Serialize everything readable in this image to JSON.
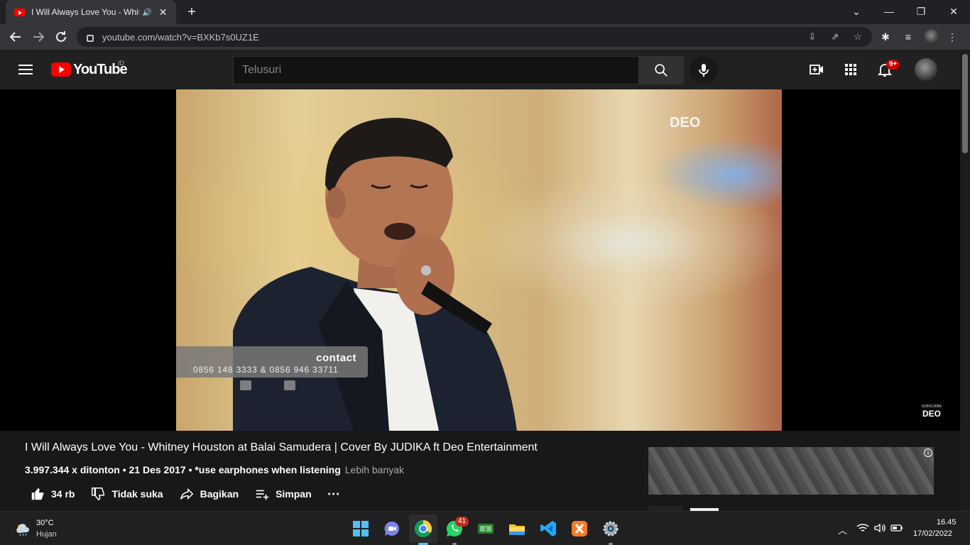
{
  "browser": {
    "tab_title": "I Will Always Love You - Whitney Houston at Balai Samudera",
    "url": "youtube.com/watch?v=BXKb7s0UZ1E"
  },
  "youtube": {
    "logo_text": "YouTube",
    "country_code": "ID",
    "search_placeholder": "Telusuri",
    "notification_count": "9+"
  },
  "video": {
    "overlay_logo": "DEO",
    "contact_title": "contact",
    "contact_phone": "0856 148 3333 & 0856 946 33711",
    "subscribe_small": "SUBSCRIBE",
    "subscribe_logo": "DEO",
    "title": "I Will Always Love You - Whitney Houston at Balai Samudera | Cover By JUDIKA ft Deo Entertainment",
    "meta": "3.997.344 x ditonton • 21 Des 2017 • *use earphones when listening",
    "more_label": "Lebih banyak",
    "actions": {
      "like": "34 rb",
      "dislike": "Tidak suka",
      "share": "Bagikan",
      "save": "Simpan"
    }
  },
  "taskbar": {
    "weather_temp": "30°C",
    "weather_desc": "Hujan",
    "whatsapp_badge": "41",
    "time": "16.45",
    "date": "17/02/2022"
  },
  "colors": {
    "youtube_red": "#ff0000",
    "background": "#181818",
    "header": "#212121"
  }
}
